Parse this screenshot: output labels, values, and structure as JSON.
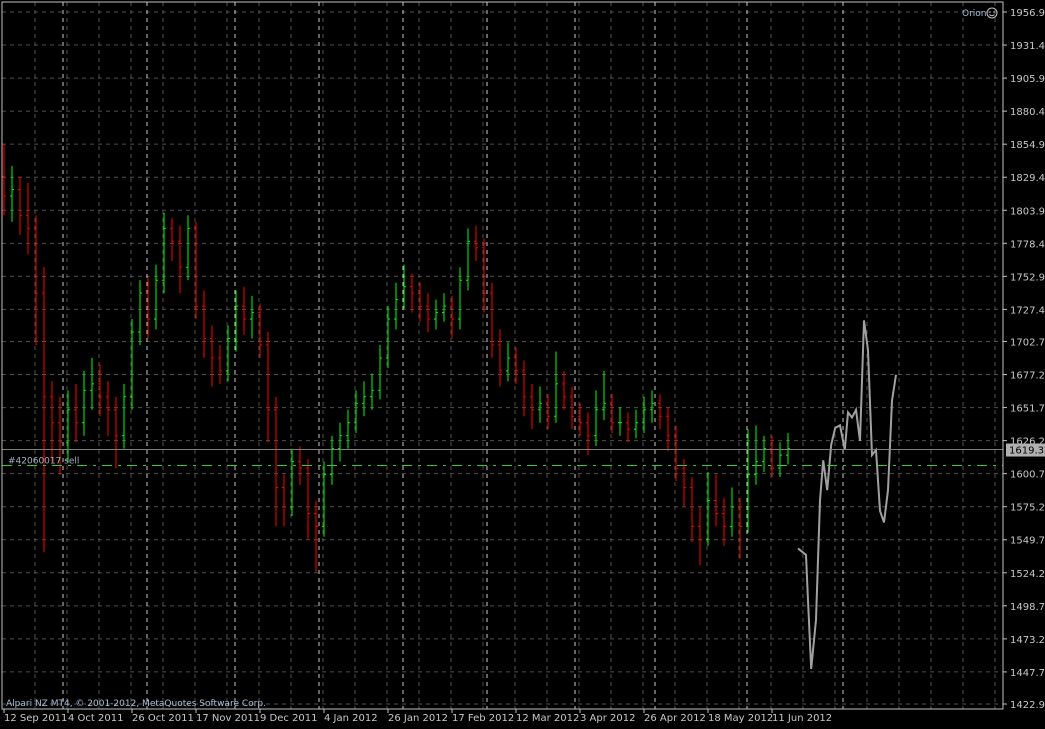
{
  "header": {
    "indicator_name": "Orion",
    "indicator_icon": "smiley-icon"
  },
  "footer": {
    "copyright": "Alpari NZ MT4, © 2001-2012, MetaQuotes Software Corp."
  },
  "order_label": "#42060017 sell",
  "current_price_label": "1619.32",
  "colors": {
    "background": "#000000",
    "bull": "#00ff00",
    "bear": "#ff0000",
    "grid": "#505050",
    "separator": "#c8c8c8",
    "forecast": "#a0a0a0",
    "order_line": "#32cd32"
  },
  "chart_data": {
    "type": "ohlc",
    "title": "",
    "ylim": [
      1422.95,
      1956.95
    ],
    "y_ticks": [
      "1956.95",
      "1931.45",
      "1905.95",
      "1880.45",
      "1854.95",
      "1829.45",
      "1803.95",
      "1778.45",
      "1752.95",
      "1727.45",
      "1702.70",
      "1677.20",
      "1651.70",
      "1626.20",
      "1600.70",
      "1575.20",
      "1549.70",
      "1524.20",
      "1498.70",
      "1473.20",
      "1447.70",
      "1422.95"
    ],
    "x_ticks": [
      "12 Sep 2011",
      "4 Oct 2011",
      "26 Oct 2011",
      "17 Nov 2011",
      "9 Dec 2011",
      "4 Jan 2012",
      "26 Jan 2012",
      "17 Feb 2012",
      "12 Mar 2012",
      "3 Apr 2012",
      "26 Apr 2012",
      "18 May 2012",
      "11 Jun 2012"
    ],
    "current_price": 1619.32,
    "order_price": 1607,
    "bars": [
      [
        1830,
        1855,
        1800,
        1815
      ],
      [
        1815,
        1838,
        1795,
        1820
      ],
      [
        1820,
        1830,
        1785,
        1800
      ],
      [
        1800,
        1825,
        1770,
        1790
      ],
      [
        1790,
        1800,
        1700,
        1740
      ],
      [
        1740,
        1760,
        1540,
        1660
      ],
      [
        1660,
        1672,
        1610,
        1640
      ],
      [
        1640,
        1660,
        1600,
        1625
      ],
      [
        1625,
        1665,
        1610,
        1650
      ],
      [
        1650,
        1670,
        1625,
        1640
      ],
      [
        1640,
        1680,
        1630,
        1665
      ],
      [
        1665,
        1690,
        1650,
        1670
      ],
      [
        1670,
        1685,
        1645,
        1660
      ],
      [
        1660,
        1672,
        1630,
        1650
      ],
      [
        1650,
        1660,
        1605,
        1630
      ],
      [
        1630,
        1670,
        1620,
        1660
      ],
      [
        1660,
        1720,
        1650,
        1710
      ],
      [
        1710,
        1750,
        1700,
        1740
      ],
      [
        1740,
        1752,
        1705,
        1720
      ],
      [
        1720,
        1762,
        1712,
        1750
      ],
      [
        1750,
        1802,
        1740,
        1790
      ],
      [
        1790,
        1798,
        1765,
        1780
      ],
      [
        1780,
        1792,
        1740,
        1760
      ],
      [
        1760,
        1800,
        1750,
        1790
      ],
      [
        1790,
        1795,
        1720,
        1730
      ],
      [
        1730,
        1742,
        1690,
        1705
      ],
      [
        1705,
        1715,
        1668,
        1690
      ],
      [
        1690,
        1700,
        1670,
        1680
      ],
      [
        1680,
        1715,
        1672,
        1705
      ],
      [
        1705,
        1742,
        1695,
        1730
      ],
      [
        1730,
        1745,
        1708,
        1720
      ],
      [
        1720,
        1738,
        1705,
        1725
      ],
      [
        1725,
        1732,
        1690,
        1700
      ],
      [
        1700,
        1710,
        1625,
        1650
      ],
      [
        1650,
        1660,
        1560,
        1590
      ],
      [
        1590,
        1600,
        1560,
        1575
      ],
      [
        1575,
        1620,
        1568,
        1610
      ],
      [
        1610,
        1622,
        1592,
        1605
      ],
      [
        1605,
        1612,
        1550,
        1570
      ],
      [
        1570,
        1580,
        1525,
        1560
      ],
      [
        1560,
        1610,
        1552,
        1600
      ],
      [
        1600,
        1630,
        1592,
        1620
      ],
      [
        1620,
        1640,
        1610,
        1630
      ],
      [
        1630,
        1650,
        1620,
        1640
      ],
      [
        1640,
        1665,
        1632,
        1655
      ],
      [
        1655,
        1672,
        1645,
        1660
      ],
      [
        1660,
        1678,
        1650,
        1665
      ],
      [
        1665,
        1700,
        1658,
        1690
      ],
      [
        1690,
        1730,
        1682,
        1720
      ],
      [
        1720,
        1748,
        1712,
        1735
      ],
      [
        1735,
        1762,
        1728,
        1745
      ],
      [
        1745,
        1755,
        1725,
        1740
      ],
      [
        1740,
        1748,
        1718,
        1730
      ],
      [
        1730,
        1740,
        1710,
        1720
      ],
      [
        1720,
        1735,
        1712,
        1725
      ],
      [
        1725,
        1740,
        1718,
        1730
      ],
      [
        1730,
        1738,
        1705,
        1720
      ],
      [
        1720,
        1760,
        1712,
        1750
      ],
      [
        1750,
        1790,
        1742,
        1780
      ],
      [
        1780,
        1792,
        1765,
        1775
      ],
      [
        1775,
        1782,
        1725,
        1740
      ],
      [
        1740,
        1748,
        1690,
        1700
      ],
      [
        1700,
        1712,
        1668,
        1680
      ],
      [
        1680,
        1702,
        1672,
        1690
      ],
      [
        1690,
        1698,
        1670,
        1680
      ],
      [
        1680,
        1688,
        1645,
        1660
      ],
      [
        1660,
        1670,
        1635,
        1650
      ],
      [
        1650,
        1668,
        1640,
        1655
      ],
      [
        1655,
        1662,
        1635,
        1645
      ],
      [
        1645,
        1695,
        1640,
        1670
      ],
      [
        1670,
        1680,
        1650,
        1660
      ],
      [
        1660,
        1668,
        1635,
        1645
      ],
      [
        1645,
        1655,
        1630,
        1640
      ],
      [
        1640,
        1648,
        1615,
        1630
      ],
      [
        1630,
        1665,
        1622,
        1650
      ],
      [
        1650,
        1680,
        1642,
        1655
      ],
      [
        1655,
        1662,
        1632,
        1640
      ],
      [
        1640,
        1652,
        1630,
        1640
      ],
      [
        1640,
        1648,
        1625,
        1635
      ],
      [
        1635,
        1650,
        1628,
        1640
      ],
      [
        1640,
        1660,
        1632,
        1650
      ],
      [
        1650,
        1665,
        1640,
        1655
      ],
      [
        1655,
        1662,
        1635,
        1645
      ],
      [
        1645,
        1652,
        1618,
        1630
      ],
      [
        1630,
        1638,
        1595,
        1605
      ],
      [
        1605,
        1612,
        1575,
        1590
      ],
      [
        1590,
        1598,
        1548,
        1560
      ],
      [
        1560,
        1575,
        1530,
        1550
      ],
      [
        1550,
        1602,
        1545,
        1580
      ],
      [
        1580,
        1600,
        1560,
        1570
      ],
      [
        1570,
        1582,
        1545,
        1560
      ],
      [
        1560,
        1590,
        1552,
        1575
      ],
      [
        1575,
        1582,
        1535,
        1560
      ],
      [
        1560,
        1635,
        1555,
        1600
      ],
      [
        1600,
        1638,
        1592,
        1610
      ],
      [
        1610,
        1630,
        1602,
        1620
      ],
      [
        1620,
        1630,
        1598,
        1605
      ],
      [
        1605,
        1625,
        1598,
        1615
      ],
      [
        1615,
        1632,
        1608,
        1620
      ]
    ],
    "forecast_line": [
      [
        99.25,
        1543
      ],
      [
        100.25,
        1538
      ],
      [
        100.5,
        1503
      ],
      [
        100.9,
        1450
      ],
      [
        101.5,
        1488
      ],
      [
        102,
        1580
      ],
      [
        102.4,
        1611
      ],
      [
        102.9,
        1588
      ],
      [
        103.4,
        1623
      ],
      [
        103.9,
        1636
      ],
      [
        104.5,
        1638
      ],
      [
        105.1,
        1619
      ],
      [
        105.5,
        1648
      ],
      [
        106,
        1644
      ],
      [
        106.5,
        1650
      ],
      [
        107,
        1626
      ],
      [
        107.5,
        1719
      ],
      [
        108,
        1696
      ],
      [
        108.5,
        1615
      ],
      [
        109,
        1619
      ],
      [
        109.5,
        1572
      ],
      [
        110,
        1563
      ],
      [
        110.5,
        1588
      ],
      [
        111,
        1657
      ],
      [
        111.5,
        1677
      ]
    ]
  }
}
